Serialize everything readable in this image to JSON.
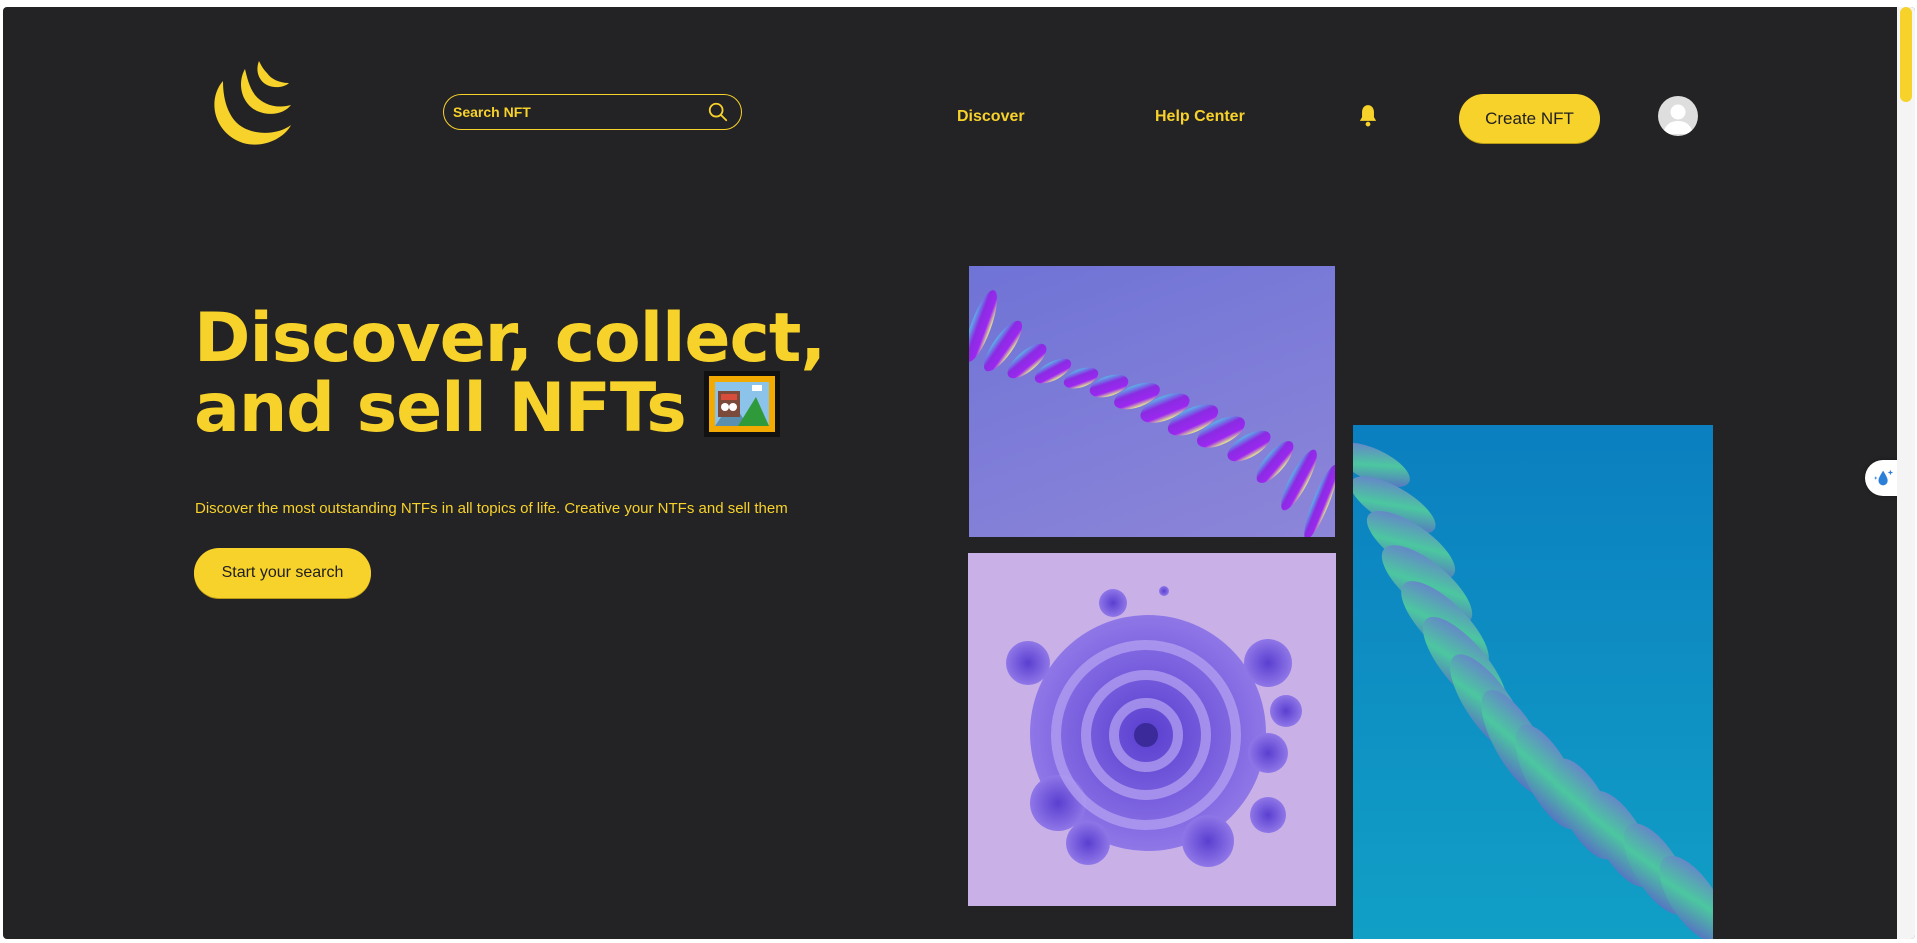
{
  "header": {
    "search_placeholder": "Search NFT",
    "nav": [
      {
        "label": "Discover"
      },
      {
        "label": "Help Center"
      }
    ],
    "create_button": "Create NFT"
  },
  "hero": {
    "title_line1": "Discover, collect,",
    "title_line2": "and sell NFTs",
    "subtitle": "Discover the most outstanding NTFs in all topics of life. Creative your NTFs and sell them",
    "cta": "Start your search"
  },
  "theme": {
    "background": "#232224",
    "accent": "#f7d22a"
  },
  "icons": [
    "logo-moon-icon",
    "search-icon",
    "bell-icon",
    "user-avatar-icon",
    "framed-picture-icon",
    "ai-assistant-icon"
  ]
}
